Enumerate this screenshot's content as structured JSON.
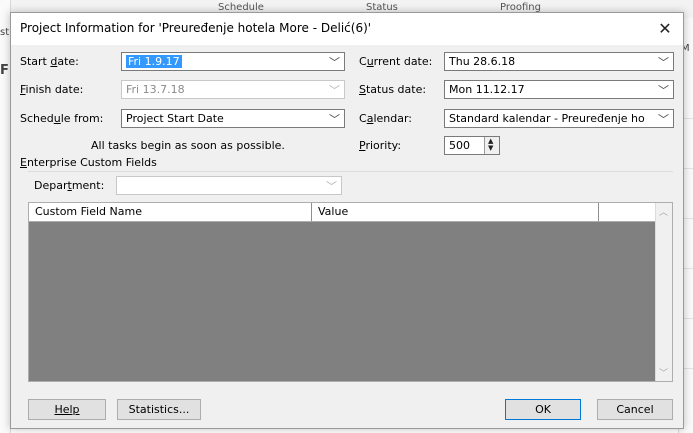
{
  "background": {
    "col_schedule": "Schedule",
    "col_status": "Status",
    "col_proofing": "Proofing",
    "left_st": "st",
    "left_f": "F",
    "right_m": "M"
  },
  "dialog": {
    "title": "Project Information for 'Preuređenje hotela More - Delić(6)'",
    "close_glyph": "✕",
    "start_date_label": "Start date:",
    "start_date_value": "Fri 1.9.17",
    "finish_date_label": "Finish date:",
    "finish_date_value": "Fri 13.7.18",
    "schedule_from_label": "Schedule from:",
    "schedule_from_value": "Project Start Date",
    "schedule_note": "All tasks begin as soon as possible.",
    "current_date_label": "Current date:",
    "current_date_value": "Thu 28.6.18",
    "status_date_label": "Status date:",
    "status_date_value": "Mon 11.12.17",
    "calendar_label": "Calendar:",
    "calendar_value": "Standard kalendar - Preuređenje ho",
    "priority_label": "Priority:",
    "priority_value": "500",
    "enterprise_label": "Enterprise Custom Fields",
    "department_label": "Department:",
    "department_value": "",
    "grid_col_name": "Custom Field Name",
    "grid_col_value": "Value",
    "help_button": "Help",
    "statistics_button": "Statistics...",
    "ok_button": "OK",
    "cancel_button": "Cancel"
  },
  "colors": {
    "selection": "#3399ff",
    "dialog_bg": "#f0f0f0",
    "grid_bg": "#808080",
    "default_button_border": "#0078d7"
  }
}
